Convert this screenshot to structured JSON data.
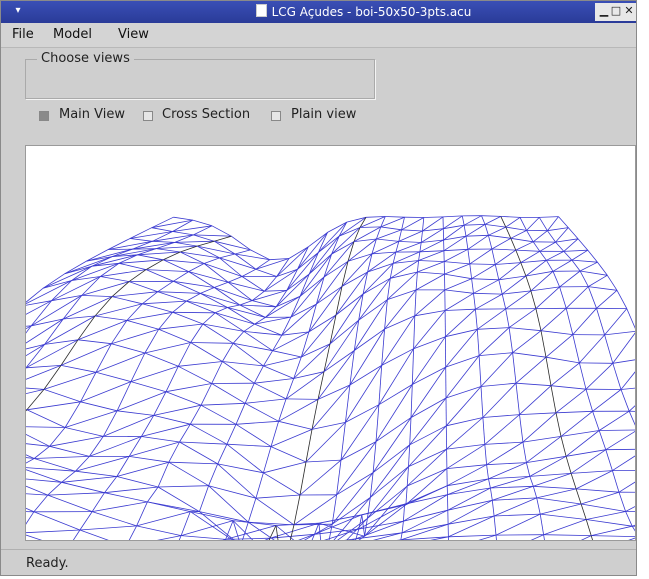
{
  "window": {
    "title": "LCG Açudes - boi-50x50-3pts.acu",
    "sysmenu_icon": "window-menu-icon",
    "controls": [
      "minimize-icon",
      "maximize-icon",
      "close-icon"
    ]
  },
  "menu": {
    "file": "File",
    "model": "Model",
    "view": "View"
  },
  "views": {
    "legend": "Choose views",
    "main": "Main View",
    "main_checked": true,
    "cross": "Cross Section",
    "cross_checked": false,
    "plain": "Plain view",
    "plain_checked": false
  },
  "colors": {
    "mesh": "#3a3ad0",
    "mesh_dark": "#2a2a2a",
    "titlebar": "#2f43a8"
  },
  "status": {
    "text": "Ready."
  }
}
